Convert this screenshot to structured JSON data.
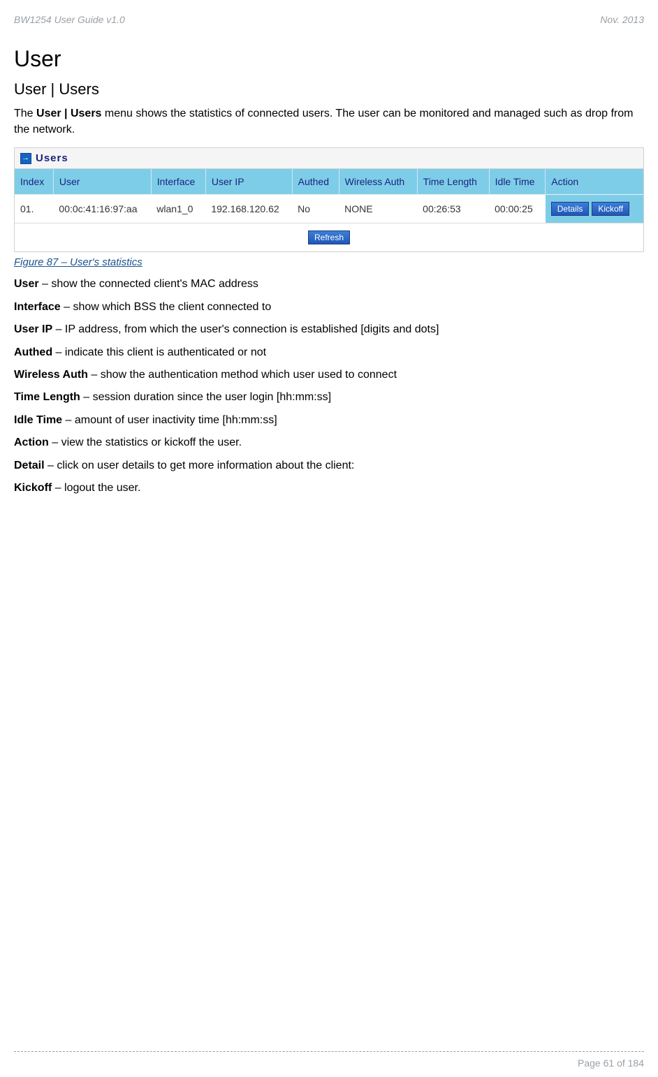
{
  "header": {
    "doc_title": "BW1254 User Guide v1.0",
    "date": "Nov.  2013"
  },
  "h1": "User",
  "h2": "User | Users",
  "intro": {
    "prefix": "The ",
    "bold": "User | Users",
    "suffix": " menu shows the statistics of connected users. The user can be monitored and managed such as drop from the network."
  },
  "panel_title": "Users",
  "table": {
    "headers": [
      "Index",
      "User",
      "Interface",
      "User IP",
      "Authed",
      "Wireless Auth",
      "Time Length",
      "Idle Time",
      "Action"
    ],
    "row": {
      "index": "01.",
      "user": "00:0c:41:16:97:aa",
      "interface": "wlan1_0",
      "user_ip": "192.168.120.62",
      "authed": "No",
      "wireless_auth": "NONE",
      "time_length": "00:26:53",
      "idle_time": "00:00:25"
    },
    "action_details": "Details",
    "action_kickoff": "Kickoff",
    "refresh": "Refresh"
  },
  "fig_caption": "Figure 87 – User's statistics",
  "definitions": [
    {
      "term": "User",
      "desc": " – show the connected client's MAC address"
    },
    {
      "term": "Interface",
      "desc": " – show which BSS the client connected to"
    },
    {
      "term": "User IP",
      "desc": " – IP address, from which the user's connection is established [digits and dots]"
    },
    {
      "term": "Authed",
      "desc": " – indicate this client is authenticated or not"
    },
    {
      "term": "Wireless Auth",
      "desc": " – show the authentication method which user used to connect"
    },
    {
      "term": "Time Length",
      "desc": " – session duration since the user login [hh:mm:ss]"
    },
    {
      "term": "Idle Time",
      "desc": " – amount of user inactivity time [hh:mm:ss]"
    },
    {
      "term": "Action",
      "desc": " – view the statistics or kickoff the user."
    },
    {
      "term": "Detail",
      "desc": " – click on user details to get more information about the client:"
    },
    {
      "term": "Kickoff",
      "desc": " – logout the user."
    }
  ],
  "footer": {
    "page": "Page 61 of 184"
  }
}
